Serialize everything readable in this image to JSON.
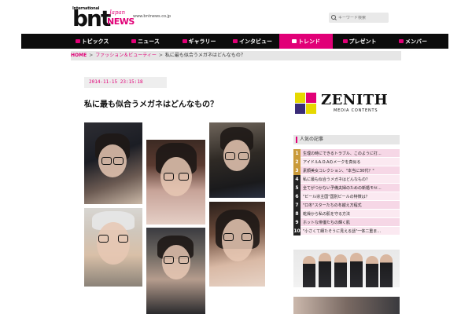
{
  "header": {
    "logo_intl": "International",
    "logo_bnt": "bnt",
    "logo_japan": "Japan",
    "logo_news": "NEWS",
    "site_url": "www.bntnews.co.jp",
    "search_placeholder": "キーワード検索"
  },
  "nav": {
    "items": [
      {
        "label": "トピックス"
      },
      {
        "label": "ニュース"
      },
      {
        "label": "ギャラリー"
      },
      {
        "label": "インタビュー"
      },
      {
        "label": "トレンド"
      },
      {
        "label": "プレゼント"
      },
      {
        "label": "メンバー"
      }
    ],
    "active": "トレンド"
  },
  "breadcrumb": {
    "home": "HOME",
    "sep": ">",
    "category": "ファッション＆ビューティー",
    "current": "私に最も似合うメガネはどんなもの？"
  },
  "article": {
    "date": "2014-11-15 23:15:18",
    "title": "私に最も似合うメガネはどんなもの？"
  },
  "sidebar": {
    "zenith_name": "ZENITH",
    "zenith_sub": "MEDIA CONTENTS",
    "popular_heading": "人気の記事",
    "popular": [
      {
        "num": "1",
        "title": "生理の時にできるトラブル、このように打..."
      },
      {
        "num": "2",
        "title": "アイドルA.O.Aのメークを真似る"
      },
      {
        "num": "3",
        "title": "素顔美女コレクション、\"本当に30代？\""
      },
      {
        "num": "4",
        "title": "私に最も似合うメガネはどんなもの？"
      },
      {
        "num": "5",
        "title": "全てがつかない予備夫婦のための新婚モセ..."
      },
      {
        "num": "6",
        "title": "\"ビール宗主国\"国別ビールの特徴は？"
      },
      {
        "num": "7",
        "title": "\"口冬\"スターたちの冬越え方程式"
      },
      {
        "num": "8",
        "title": "乾燥から私の肌を守る方法"
      },
      {
        "num": "9",
        "title": "ホットな俳優たちの輝く肌"
      },
      {
        "num": "10",
        "title": "\"小さくて細たそうに見える話\"一体二重ま..."
      }
    ]
  },
  "colors": {
    "accent": "#e10077",
    "nav_bg": "#0c0c0c"
  }
}
